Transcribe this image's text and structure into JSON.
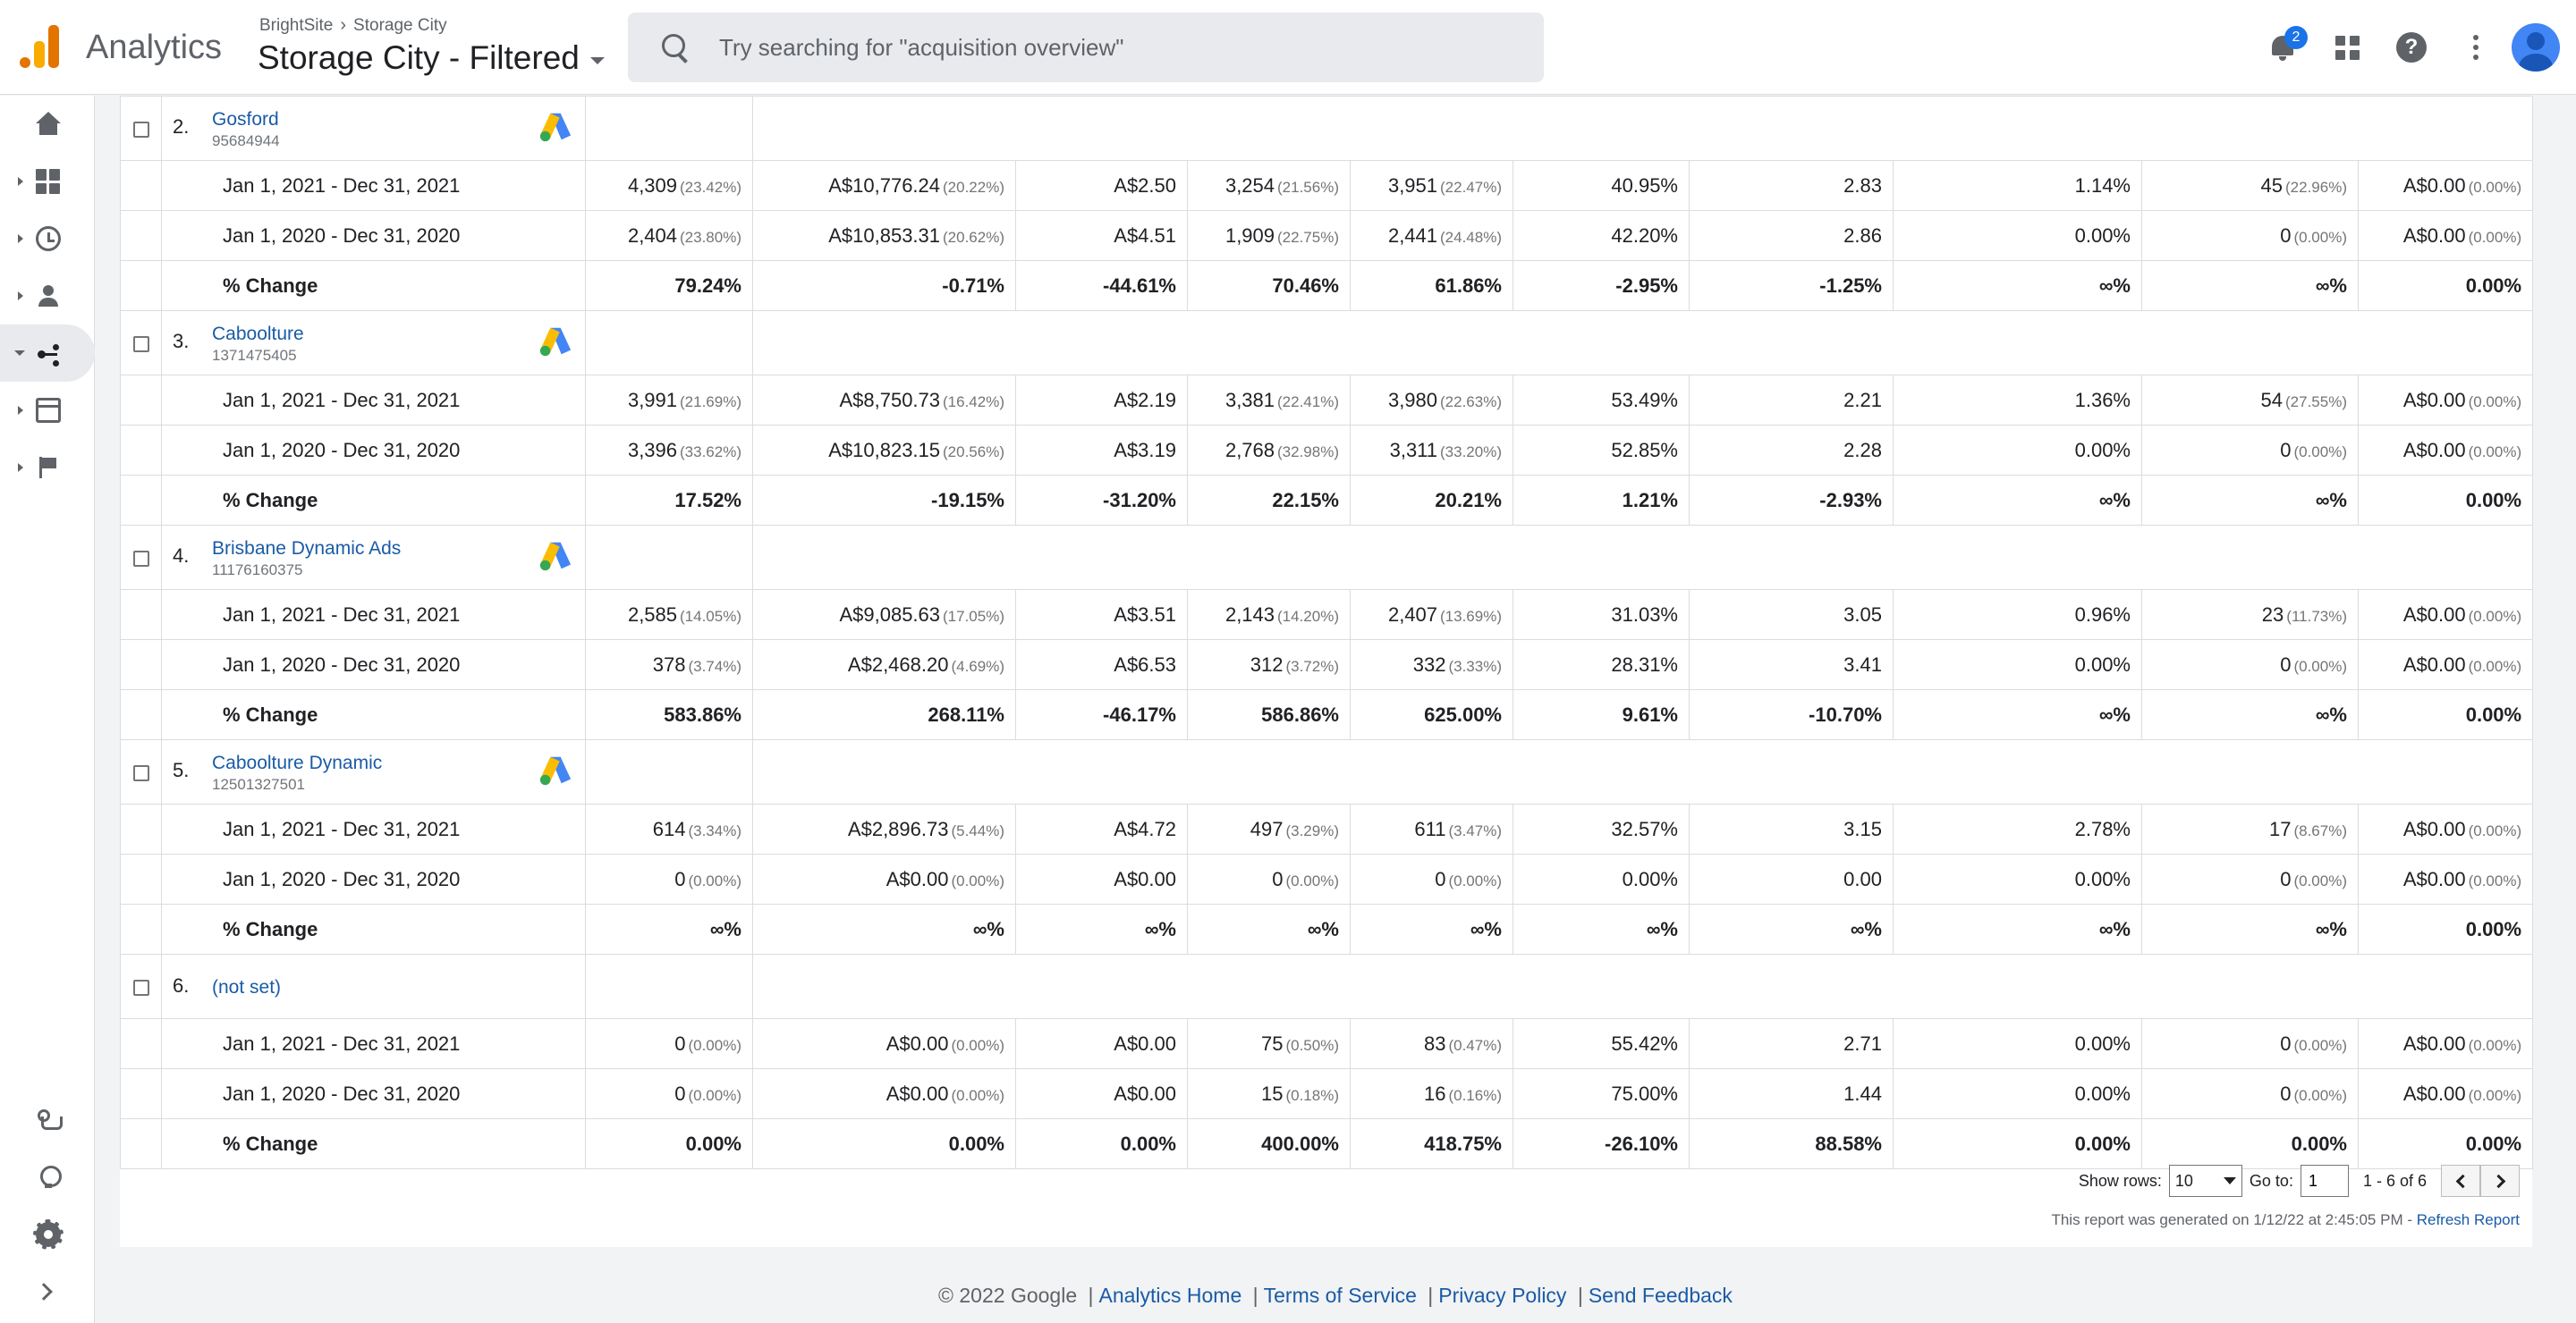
{
  "header": {
    "app_name": "Analytics",
    "breadcrumb": [
      "BrightSite",
      "Storage City"
    ],
    "property_title": "Storage City - Filtered",
    "search_placeholder": "Try searching for \"acquisition overview\"",
    "notification_count": "2",
    "help_glyph": "?"
  },
  "sidebar": {
    "items": [
      {
        "name": "home-icon",
        "has_caret": false
      },
      {
        "name": "customization-icon",
        "has_caret": true
      },
      {
        "name": "realtime-icon",
        "has_caret": true
      },
      {
        "name": "audience-icon",
        "has_caret": true
      },
      {
        "name": "acquisition-icon",
        "has_caret": true,
        "active": true
      },
      {
        "name": "behavior-icon",
        "has_caret": true
      },
      {
        "name": "conversions-icon",
        "has_caret": true
      }
    ],
    "bottom_items": [
      "attribution-icon",
      "discover-icon",
      "admin-icon",
      "expand-icon"
    ]
  },
  "table": {
    "groups": [
      {
        "index": "2.",
        "name": "Gosford",
        "id": "95684944",
        "rows": [
          {
            "label": "Jan 1, 2021 - Dec 31, 2021",
            "cells": [
              [
                "4,309",
                "(23.42%)"
              ],
              [
                "A$10,776.24",
                "(20.22%)"
              ],
              [
                "A$2.50",
                ""
              ],
              [
                "3,254",
                "(21.56%)"
              ],
              [
                "3,951",
                "(22.47%)"
              ],
              [
                "40.95%",
                ""
              ],
              [
                "2.83",
                ""
              ],
              [
                "1.14%",
                ""
              ],
              [
                "45",
                "(22.96%)"
              ],
              [
                "A$0.00",
                "(0.00%)"
              ]
            ]
          },
          {
            "label": "Jan 1, 2020 - Dec 31, 2020",
            "cells": [
              [
                "2,404",
                "(23.80%)"
              ],
              [
                "A$10,853.31",
                "(20.62%)"
              ],
              [
                "A$4.51",
                ""
              ],
              [
                "1,909",
                "(22.75%)"
              ],
              [
                "2,441",
                "(24.48%)"
              ],
              [
                "42.20%",
                ""
              ],
              [
                "2.86",
                ""
              ],
              [
                "0.00%",
                ""
              ],
              [
                "0",
                "(0.00%)"
              ],
              [
                "A$0.00",
                "(0.00%)"
              ]
            ]
          },
          {
            "label": "% Change",
            "change": true,
            "cells": [
              [
                "79.24%",
                ""
              ],
              [
                "-0.71%",
                ""
              ],
              [
                "-44.61%",
                ""
              ],
              [
                "70.46%",
                ""
              ],
              [
                "61.86%",
                ""
              ],
              [
                "-2.95%",
                ""
              ],
              [
                "-1.25%",
                ""
              ],
              [
                "∞%",
                ""
              ],
              [
                "∞%",
                ""
              ],
              [
                "0.00%",
                ""
              ]
            ]
          }
        ]
      },
      {
        "index": "3.",
        "name": "Caboolture",
        "id": "1371475405",
        "rows": [
          {
            "label": "Jan 1, 2021 - Dec 31, 2021",
            "cells": [
              [
                "3,991",
                "(21.69%)"
              ],
              [
                "A$8,750.73",
                "(16.42%)"
              ],
              [
                "A$2.19",
                ""
              ],
              [
                "3,381",
                "(22.41%)"
              ],
              [
                "3,980",
                "(22.63%)"
              ],
              [
                "53.49%",
                ""
              ],
              [
                "2.21",
                ""
              ],
              [
                "1.36%",
                ""
              ],
              [
                "54",
                "(27.55%)"
              ],
              [
                "A$0.00",
                "(0.00%)"
              ]
            ]
          },
          {
            "label": "Jan 1, 2020 - Dec 31, 2020",
            "cells": [
              [
                "3,396",
                "(33.62%)"
              ],
              [
                "A$10,823.15",
                "(20.56%)"
              ],
              [
                "A$3.19",
                ""
              ],
              [
                "2,768",
                "(32.98%)"
              ],
              [
                "3,311",
                "(33.20%)"
              ],
              [
                "52.85%",
                ""
              ],
              [
                "2.28",
                ""
              ],
              [
                "0.00%",
                ""
              ],
              [
                "0",
                "(0.00%)"
              ],
              [
                "A$0.00",
                "(0.00%)"
              ]
            ]
          },
          {
            "label": "% Change",
            "change": true,
            "cells": [
              [
                "17.52%",
                ""
              ],
              [
                "-19.15%",
                ""
              ],
              [
                "-31.20%",
                ""
              ],
              [
                "22.15%",
                ""
              ],
              [
                "20.21%",
                ""
              ],
              [
                "1.21%",
                ""
              ],
              [
                "-2.93%",
                ""
              ],
              [
                "∞%",
                ""
              ],
              [
                "∞%",
                ""
              ],
              [
                "0.00%",
                ""
              ]
            ]
          }
        ]
      },
      {
        "index": "4.",
        "name": "Brisbane Dynamic Ads",
        "id": "11176160375",
        "rows": [
          {
            "label": "Jan 1, 2021 - Dec 31, 2021",
            "cells": [
              [
                "2,585",
                "(14.05%)"
              ],
              [
                "A$9,085.63",
                "(17.05%)"
              ],
              [
                "A$3.51",
                ""
              ],
              [
                "2,143",
                "(14.20%)"
              ],
              [
                "2,407",
                "(13.69%)"
              ],
              [
                "31.03%",
                ""
              ],
              [
                "3.05",
                ""
              ],
              [
                "0.96%",
                ""
              ],
              [
                "23",
                "(11.73%)"
              ],
              [
                "A$0.00",
                "(0.00%)"
              ]
            ]
          },
          {
            "label": "Jan 1, 2020 - Dec 31, 2020",
            "cells": [
              [
                "378",
                "(3.74%)"
              ],
              [
                "A$2,468.20",
                "(4.69%)"
              ],
              [
                "A$6.53",
                ""
              ],
              [
                "312",
                "(3.72%)"
              ],
              [
                "332",
                "(3.33%)"
              ],
              [
                "28.31%",
                ""
              ],
              [
                "3.41",
                ""
              ],
              [
                "0.00%",
                ""
              ],
              [
                "0",
                "(0.00%)"
              ],
              [
                "A$0.00",
                "(0.00%)"
              ]
            ]
          },
          {
            "label": "% Change",
            "change": true,
            "cells": [
              [
                "583.86%",
                ""
              ],
              [
                "268.11%",
                ""
              ],
              [
                "-46.17%",
                ""
              ],
              [
                "586.86%",
                ""
              ],
              [
                "625.00%",
                ""
              ],
              [
                "9.61%",
                ""
              ],
              [
                "-10.70%",
                ""
              ],
              [
                "∞%",
                ""
              ],
              [
                "∞%",
                ""
              ],
              [
                "0.00%",
                ""
              ]
            ]
          }
        ]
      },
      {
        "index": "5.",
        "name": "Caboolture Dynamic",
        "id": "12501327501",
        "rows": [
          {
            "label": "Jan 1, 2021 - Dec 31, 2021",
            "cells": [
              [
                "614",
                "(3.34%)"
              ],
              [
                "A$2,896.73",
                "(5.44%)"
              ],
              [
                "A$4.72",
                ""
              ],
              [
                "497",
                "(3.29%)"
              ],
              [
                "611",
                "(3.47%)"
              ],
              [
                "32.57%",
                ""
              ],
              [
                "3.15",
                ""
              ],
              [
                "2.78%",
                ""
              ],
              [
                "17",
                "(8.67%)"
              ],
              [
                "A$0.00",
                "(0.00%)"
              ]
            ]
          },
          {
            "label": "Jan 1, 2020 - Dec 31, 2020",
            "cells": [
              [
                "0",
                "(0.00%)"
              ],
              [
                "A$0.00",
                "(0.00%)"
              ],
              [
                "A$0.00",
                ""
              ],
              [
                "0",
                "(0.00%)"
              ],
              [
                "0",
                "(0.00%)"
              ],
              [
                "0.00%",
                ""
              ],
              [
                "0.00",
                ""
              ],
              [
                "0.00%",
                ""
              ],
              [
                "0",
                "(0.00%)"
              ],
              [
                "A$0.00",
                "(0.00%)"
              ]
            ]
          },
          {
            "label": "% Change",
            "change": true,
            "cells": [
              [
                "∞%",
                ""
              ],
              [
                "∞%",
                ""
              ],
              [
                "∞%",
                ""
              ],
              [
                "∞%",
                ""
              ],
              [
                "∞%",
                ""
              ],
              [
                "∞%",
                ""
              ],
              [
                "∞%",
                ""
              ],
              [
                "∞%",
                ""
              ],
              [
                "∞%",
                ""
              ],
              [
                "0.00%",
                ""
              ]
            ]
          }
        ]
      },
      {
        "index": "6.",
        "name": "(not set)",
        "id": "",
        "rows": [
          {
            "label": "Jan 1, 2021 - Dec 31, 2021",
            "cells": [
              [
                "0",
                "(0.00%)"
              ],
              [
                "A$0.00",
                "(0.00%)"
              ],
              [
                "A$0.00",
                ""
              ],
              [
                "75",
                "(0.50%)"
              ],
              [
                "83",
                "(0.47%)"
              ],
              [
                "55.42%",
                ""
              ],
              [
                "2.71",
                ""
              ],
              [
                "0.00%",
                ""
              ],
              [
                "0",
                "(0.00%)"
              ],
              [
                "A$0.00",
                "(0.00%)"
              ]
            ]
          },
          {
            "label": "Jan 1, 2020 - Dec 31, 2020",
            "cells": [
              [
                "0",
                "(0.00%)"
              ],
              [
                "A$0.00",
                "(0.00%)"
              ],
              [
                "A$0.00",
                ""
              ],
              [
                "15",
                "(0.18%)"
              ],
              [
                "16",
                "(0.16%)"
              ],
              [
                "75.00%",
                ""
              ],
              [
                "1.44",
                ""
              ],
              [
                "0.00%",
                ""
              ],
              [
                "0",
                "(0.00%)"
              ],
              [
                "A$0.00",
                "(0.00%)"
              ]
            ]
          },
          {
            "label": "% Change",
            "change": true,
            "cells": [
              [
                "0.00%",
                ""
              ],
              [
                "0.00%",
                ""
              ],
              [
                "0.00%",
                ""
              ],
              [
                "400.00%",
                ""
              ],
              [
                "418.75%",
                ""
              ],
              [
                "-26.10%",
                ""
              ],
              [
                "88.58%",
                ""
              ],
              [
                "0.00%",
                ""
              ],
              [
                "0.00%",
                ""
              ],
              [
                "0.00%",
                ""
              ]
            ]
          }
        ]
      }
    ]
  },
  "pager": {
    "show_rows_label": "Show rows:",
    "show_rows_value": "10",
    "goto_label": "Go to:",
    "goto_value": "1",
    "range_text": "1 - 6 of 6"
  },
  "generated": {
    "text": "This report was generated on 1/12/22 at 2:45:05 PM - ",
    "refresh_label": "Refresh Report"
  },
  "footer": {
    "copyright": "© 2022 Google",
    "links": [
      "Analytics Home",
      "Terms of Service",
      "Privacy Policy",
      "Send Feedback"
    ]
  },
  "colors": {
    "link": "#1a5ba6",
    "accent": "#1a73e8",
    "logo_orange": "#e37400",
    "logo_yellow": "#f9ab00",
    "ads_blue": "#4285f4",
    "ads_yellow": "#fbbc04",
    "ads_green": "#34a853"
  }
}
